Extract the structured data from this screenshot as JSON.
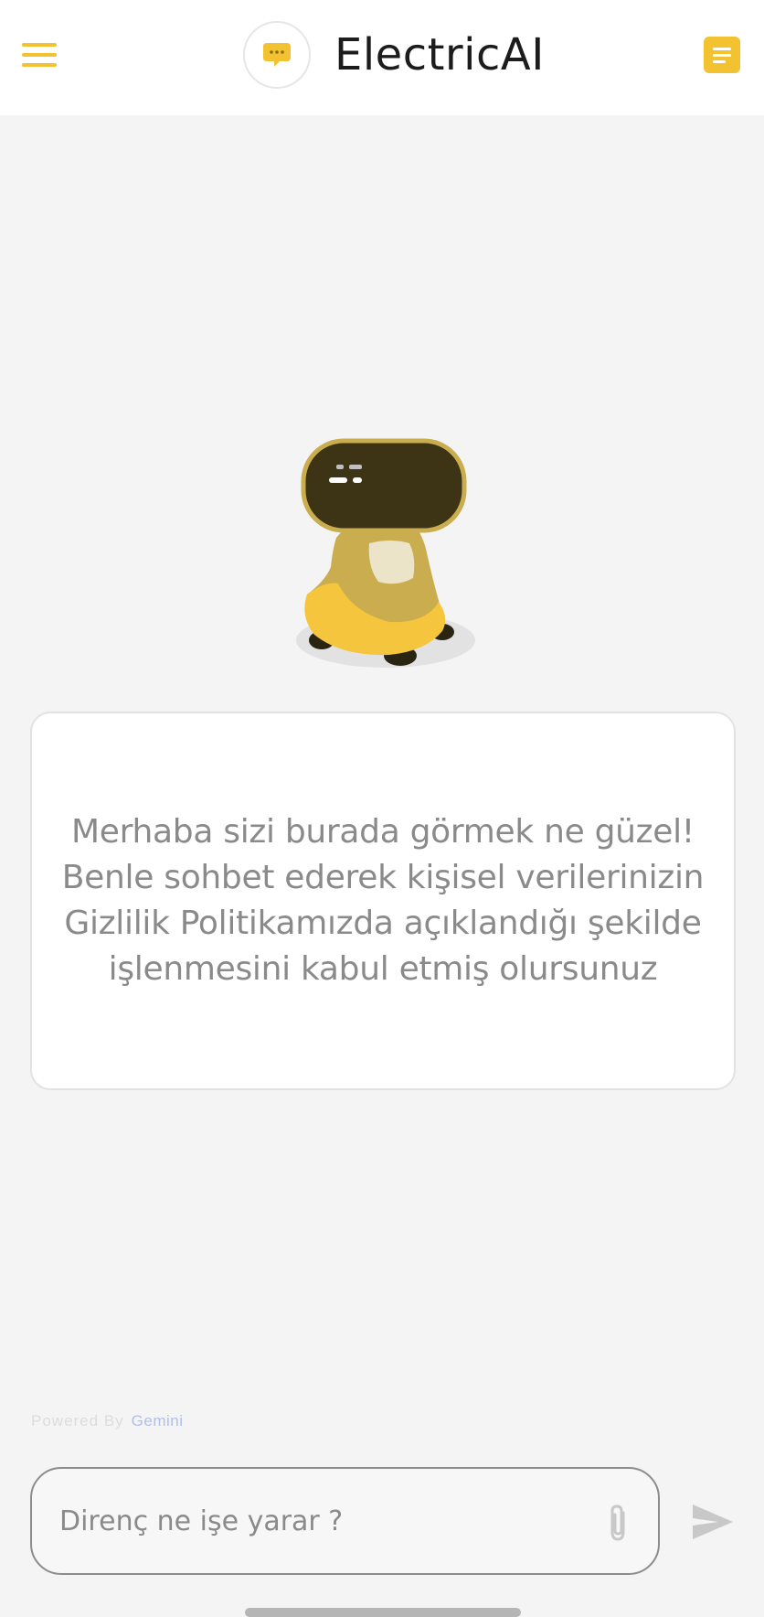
{
  "header": {
    "title": "ElectricAI"
  },
  "welcome": {
    "line1": "Merhaba sizi burada görmek ne güzel!",
    "line2": "Benle sohbet ederek kişisel verilerinizin",
    "line3": "Gizlilik Politikamızda açıklandığı şekilde",
    "line4": "işlenmesini kabul etmiş olursunuz"
  },
  "footer": {
    "powered_by": "Powered By",
    "provider": "Gemini"
  },
  "input": {
    "placeholder": "Direnç ne işe yarar ?",
    "value": ""
  },
  "icons": {
    "menu": "hamburger-menu-icon",
    "logo": "chat-bubble-icon",
    "notes": "notes-icon",
    "attach": "paperclip-icon",
    "send": "send-icon"
  },
  "colors": {
    "accent": "#f2c230",
    "background": "#f4f4f4",
    "card": "#ffffff",
    "text_muted": "#8a8a8a",
    "robot_screen": "#3d3416",
    "robot_body": "#c9ad4e"
  }
}
